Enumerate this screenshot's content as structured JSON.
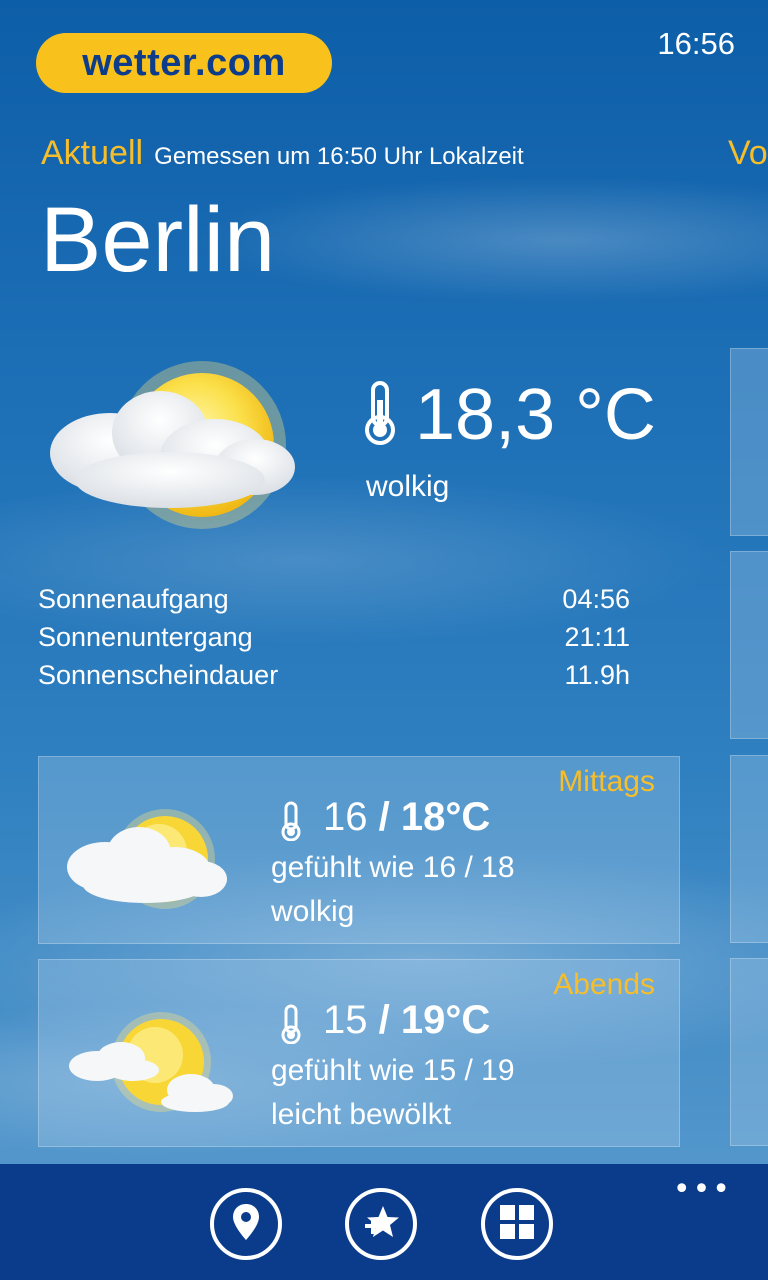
{
  "header": {
    "logo_text": "wetter.com",
    "clock": "16:56",
    "section_label": "Aktuell",
    "measured_text": "Gemessen um 16:50 Uhr Lokalzeit",
    "next_section_peek": "Vo"
  },
  "current": {
    "city": "Berlin",
    "temperature": "18,3 °C",
    "condition": "wolkig",
    "icon": "sun-behind-cloud-icon"
  },
  "sun_info": [
    {
      "label": "Sonnenaufgang",
      "value": "04:56"
    },
    {
      "label": "Sonnenuntergang",
      "value": "21:11"
    },
    {
      "label": "Sonnenscheindauer",
      "value": "11.9h"
    }
  ],
  "forecast": [
    {
      "period": "Mittags",
      "temp_low": "16",
      "separator": " / ",
      "temp_high": "18°C",
      "feels_like": "gefühlt wie 16 / 18",
      "condition": "wolkig",
      "icon": "sun-behind-cloud-icon"
    },
    {
      "period": "Abends",
      "temp_low": "15",
      "separator": " / ",
      "temp_high": "19°C",
      "feels_like": "gefühlt wie 15 / 19",
      "condition": "leicht bewölkt",
      "icon": "sun-small-clouds-icon"
    }
  ],
  "appbar": {
    "buttons": [
      "location-icon",
      "add-favorite-icon",
      "pin-tile-icon"
    ],
    "more": "•••"
  },
  "colors": {
    "accent": "#f7be2a",
    "logo_bg": "#f9c11b",
    "logo_text": "#0d3d8a",
    "appbar_bg": "#0b3c8c"
  }
}
